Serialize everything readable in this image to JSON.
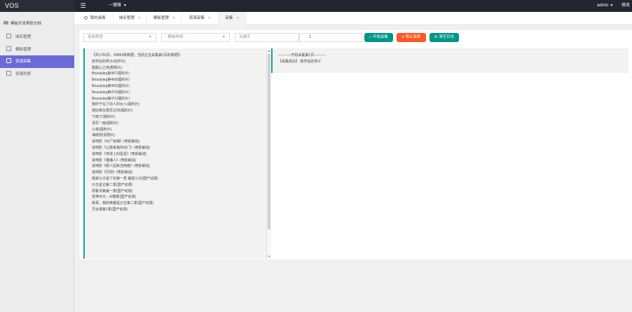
{
  "app": {
    "brand": "VOS",
    "top_nav_label": "一键维",
    "user": "admin",
    "extra": "修改"
  },
  "sidebar": {
    "section_title": "模板开发帮助文档",
    "items": [
      {
        "label": "域名管理",
        "icon": "domain-icon",
        "active": false
      },
      {
        "label": "模板管理",
        "icon": "template-icon",
        "active": false
      },
      {
        "label": "资源采集",
        "icon": "collect-icon",
        "active": true
      },
      {
        "label": "资源列表",
        "icon": "list-icon",
        "active": false
      }
    ]
  },
  "tabs": [
    {
      "label": "我的桌面",
      "closable": false,
      "icon": "home-icon"
    },
    {
      "label": "域名管理",
      "closable": true
    },
    {
      "label": "模板管理",
      "closable": true
    },
    {
      "label": "资源采集",
      "closable": true
    },
    {
      "label": "采集",
      "closable": true,
      "active": true
    }
  ],
  "filters": {
    "category_select": "全部类型",
    "time_select": "- 更新时间 -",
    "keyword_placeholder": "关键字",
    "page_value": "1"
  },
  "buttons": {
    "start": "开始采集",
    "stop": "停止采集",
    "clear": "清空日志"
  },
  "colors": {
    "accent": "#009688",
    "danger": "#ff5722",
    "sidebar_active": "#6b6bd8",
    "topbar": "#23262e"
  },
  "result_list": {
    "lines": [
      "【共1755页，43853条数据，当前正在采集第1页的数据】：",
      "放学后的男子(动作片)",
      "甜甜心之死(剧情片)",
      "Beautyleg第467(福利片)",
      "Beautyleg第468(福利片)",
      "Beautyleg第469(福利片)",
      "Beautyleg第470(福利片)",
      "Beautyleg第471(福利片)",
      "我终于在了别人的女人(福利片)",
      "我好像在那见过你(福利片)",
      "下雨了(福利片)",
      "请见一面(福利片)",
      "小孩(福利片)",
      "海底捞(喜剧片)",
      "说电影《女尸追魂》(电影解说)",
      "说电影《让我来抱你出门》(电影解说)",
      "说电影《地球上的星星》(电影解说)",
      "说电影《猫捕人》(电影解说)",
      "说电影《假人回来当西施》(电影解说)",
      "说电影《历劫》(电影解说)",
      "我家公子是个狂第一季 播放三日(国产动漫)",
      "沙丘星记第二季(国产动漫)",
      "周鲁评第第一季(国产动漫)",
      "逆神天元：AI模新(国产动漫)",
      "故事，我的英雄是沙丘第二季(国产动漫)",
      "灵台尊第1季(国产动漫)"
    ]
  },
  "log": {
    "lines": [
      "-----------开始采集第1页----------",
      "【采集成功】:放学后的男子"
    ]
  }
}
